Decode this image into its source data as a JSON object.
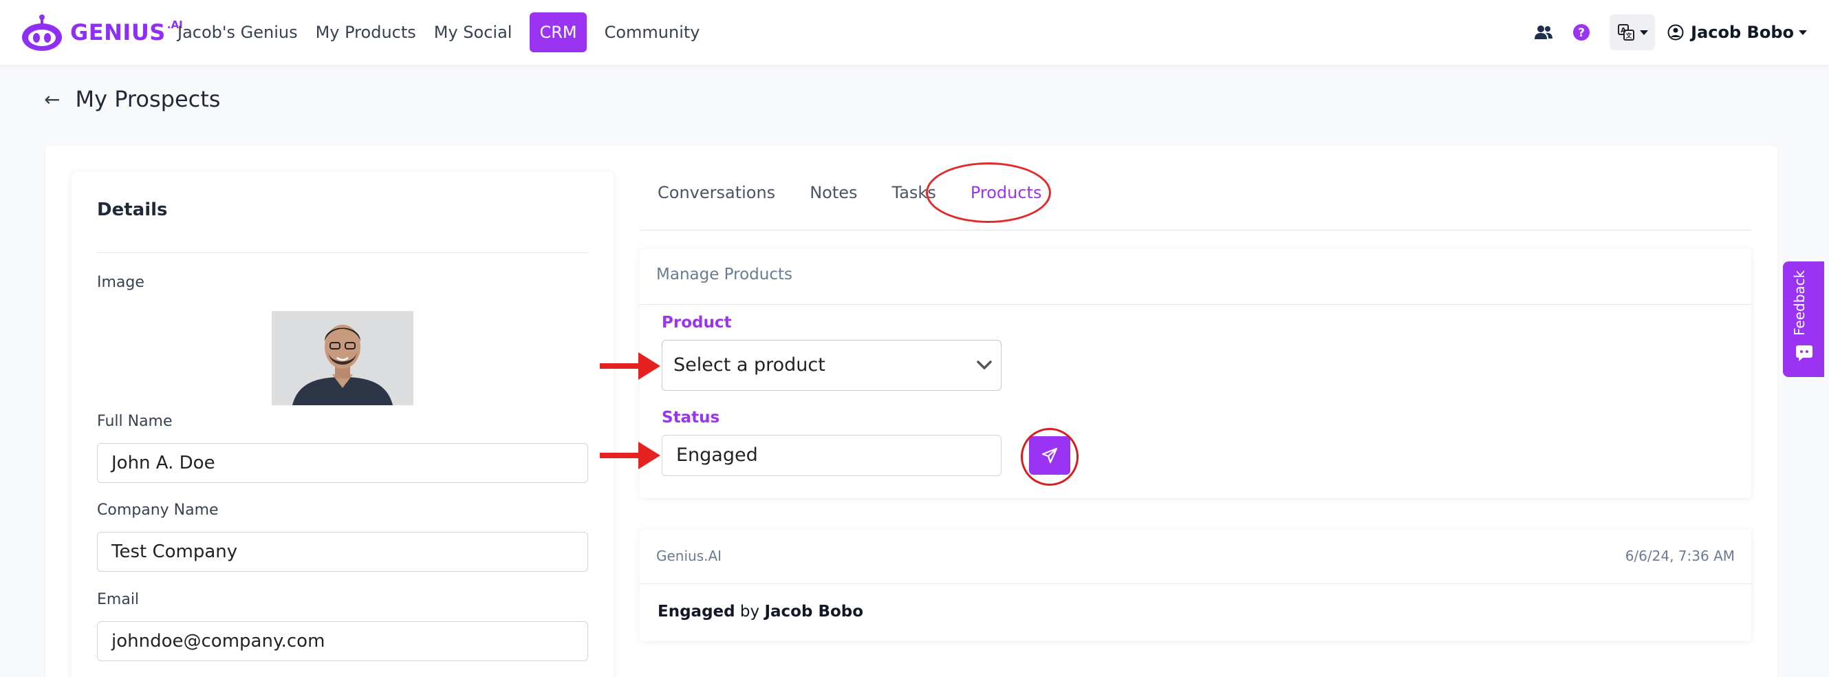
{
  "brand": {
    "name": "GENIUS",
    "suffix": ".AI"
  },
  "nav": {
    "items": [
      "Jacob's Genius",
      "My Products",
      "My Social",
      "CRM",
      "Community"
    ],
    "active": "CRM"
  },
  "user": {
    "name": "Jacob Bobo"
  },
  "page": {
    "title": "My Prospects"
  },
  "details": {
    "title": "Details",
    "image_label": "Image",
    "full_name_label": "Full Name",
    "full_name_value": "John A. Doe",
    "company_label": "Company Name",
    "company_value": "Test Company",
    "email_label": "Email",
    "email_value": "johndoe@company.com"
  },
  "tabs": [
    "Conversations",
    "Notes",
    "Tasks",
    "Products"
  ],
  "active_tab": "Products",
  "manage": {
    "title": "Manage Products",
    "product_label": "Product",
    "product_placeholder": "Select a product",
    "status_label": "Status",
    "status_value": "Engaged"
  },
  "activity": {
    "source": "Genius.AI",
    "timestamp": "6/6/24, 7:36 AM",
    "status": "Engaged",
    "by_text": "by",
    "user": "Jacob Bobo"
  },
  "feedback": {
    "label": "Feedback"
  },
  "colors": {
    "accent": "#9b34f2",
    "annotation_red": "#e12a2a",
    "muted_text": "#6b7b93"
  }
}
